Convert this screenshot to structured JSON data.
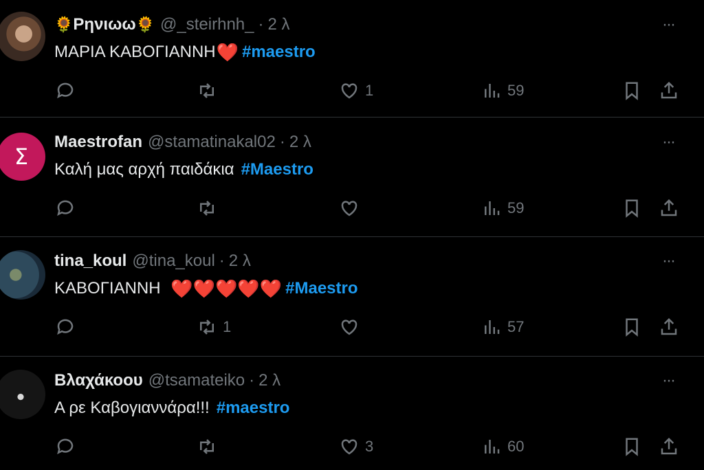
{
  "tweets": [
    {
      "name": "Ρηνιωω",
      "flower_left": "🌻",
      "flower_right": "🌻",
      "handle": "@_steirhnh_",
      "dot": "·",
      "time": "2 λ",
      "text": "ΜΑΡΙΑ ΚΑΒΟΓΙΑΝΝΗ",
      "hearts": "❤️",
      "hashtag": "#maestro",
      "replies": "",
      "retweets": "",
      "likes": "1",
      "views": "59"
    },
    {
      "name": "Maestrofan",
      "avatar_letter": "Σ",
      "handle": "@stamatinakal02",
      "dot": "·",
      "time": "2 λ",
      "text": "Καλή μας αρχή παιδάκια",
      "hashtag": "#Maestro",
      "replies": "",
      "retweets": "",
      "likes": "",
      "views": "59"
    },
    {
      "name": "tina_koul",
      "handle": "@tina_koul",
      "dot": "·",
      "time": "2 λ",
      "text": "ΚΑΒΟΓΙΑΝΝΗ ",
      "hearts": "❤️❤️❤️❤️❤️",
      "hashtag": "#Maestro",
      "replies": "",
      "retweets": "1",
      "likes": "",
      "views": "57"
    },
    {
      "name": "Βλαχάκοου",
      "handle": "@tsamateiko",
      "dot": "·",
      "time": "2 λ",
      "text": "Α ρε Καβογιαννάρα!!!",
      "hashtag": "#maestro",
      "replies": "",
      "retweets": "",
      "likes": "3",
      "views": "60"
    }
  ],
  "more_label": "···",
  "colors": {
    "background": "#000000",
    "text": "#e7e9ea",
    "muted": "#71767b",
    "hashtag": "#1d9bf0",
    "heart": "#f4212e",
    "divider": "#2f3336"
  },
  "icons": [
    "reply-icon",
    "retweet-icon",
    "like-icon",
    "views-icon",
    "bookmark-icon",
    "share-icon",
    "more-icon"
  ]
}
